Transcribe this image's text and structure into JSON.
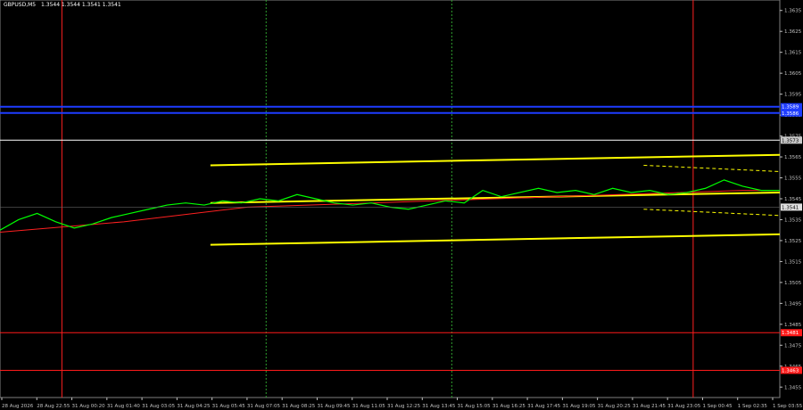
{
  "header": {
    "symbol": "GBPUSD,M5",
    "ohlc": "1.3544 1.3544 1.3541 1.3541"
  },
  "chart_data": {
    "type": "line",
    "title": "GBPUSD,M5  1.3544 1.3544 1.3541 1.3541",
    "ylim": [
      1.345,
      1.364
    ],
    "y_ticks": [
      "1.3635",
      "1.3625",
      "1.3615",
      "1.3605",
      "1.3595",
      "1.3585",
      "1.3575",
      "1.3565",
      "1.3555",
      "1.3545",
      "1.3535",
      "1.3525",
      "1.3515",
      "1.3505",
      "1.3495",
      "1.3485",
      "1.3475",
      "1.3465",
      "1.3455"
    ],
    "x_ticks": [
      "28 Aug 2026",
      "28 Aug 22:55",
      "31 Aug 00:20",
      "31 Aug 01:40",
      "31 Aug 03:05",
      "31 Aug 04:25",
      "31 Aug 05:45",
      "31 Aug 07:05",
      "31 Aug 08:25",
      "31 Aug 09:45",
      "31 Aug 11:05",
      "31 Aug 12:25",
      "31 Aug 13:45",
      "31 Aug 15:05",
      "31 Aug 16:25",
      "31 Aug 17:45",
      "31 Aug 19:05",
      "31 Aug 20:25",
      "31 Aug 21:45",
      "31 Aug 23:05",
      "1 Sep 00:45",
      "1 Sep 02:35",
      "1 Sep 03:55"
    ],
    "price_points": [
      [
        0,
        1.353
      ],
      [
        3,
        1.3535
      ],
      [
        6,
        1.3538
      ],
      [
        9,
        1.3534
      ],
      [
        12,
        1.3531
      ],
      [
        15,
        1.3533
      ],
      [
        18,
        1.3536
      ],
      [
        21,
        1.3538
      ],
      [
        24,
        1.354
      ],
      [
        27,
        1.3542
      ],
      [
        30,
        1.3543
      ],
      [
        33,
        1.3542
      ],
      [
        36,
        1.3544
      ],
      [
        39,
        1.3543
      ],
      [
        42,
        1.3545
      ],
      [
        45,
        1.3544
      ],
      [
        48,
        1.3547
      ],
      [
        51,
        1.3545
      ],
      [
        54,
        1.3543
      ],
      [
        57,
        1.3542
      ],
      [
        60,
        1.3543
      ],
      [
        63,
        1.3541
      ],
      [
        66,
        1.354
      ],
      [
        69,
        1.3542
      ],
      [
        72,
        1.3544
      ],
      [
        75,
        1.3543
      ],
      [
        78,
        1.3549
      ],
      [
        81,
        1.3546
      ],
      [
        84,
        1.3548
      ],
      [
        87,
        1.355
      ],
      [
        90,
        1.3548
      ],
      [
        93,
        1.3549
      ],
      [
        96,
        1.3547
      ],
      [
        99,
        1.355
      ],
      [
        102,
        1.3548
      ],
      [
        105,
        1.3549
      ],
      [
        108,
        1.3547
      ],
      [
        111,
        1.3548
      ],
      [
        114,
        1.355
      ],
      [
        117,
        1.3554
      ],
      [
        120,
        1.3551
      ],
      [
        123,
        1.3549
      ],
      [
        126,
        1.3549
      ]
    ],
    "ma_points": [
      [
        0,
        1.3529
      ],
      [
        20,
        1.3534
      ],
      [
        40,
        1.3541
      ],
      [
        60,
        1.3543
      ],
      [
        80,
        1.3545
      ],
      [
        100,
        1.3547
      ],
      [
        120,
        1.3549
      ],
      [
        126,
        1.3549
      ]
    ],
    "channel_upper": [
      [
        34,
        1.3561
      ],
      [
        126,
        1.3566
      ]
    ],
    "channel_middle": [
      [
        34,
        1.3543
      ],
      [
        126,
        1.3548
      ]
    ],
    "channel_lower": [
      [
        34,
        1.3523
      ],
      [
        126,
        1.3528
      ]
    ],
    "dashed_upper": [
      [
        104,
        1.3561
      ],
      [
        126,
        1.3558
      ]
    ],
    "dashed_lower": [
      [
        104,
        1.354
      ],
      [
        126,
        1.3537
      ]
    ],
    "horizontal_levels": [
      {
        "label": "1.3589",
        "value": 1.3589,
        "color": "#1e3cff"
      },
      {
        "label": "1.3586",
        "value": 1.3586,
        "color": "#1e3cff"
      },
      {
        "label": "1.3573",
        "value": 1.3573,
        "color": "#ffffff"
      },
      {
        "label": "1.3481",
        "value": 1.3481,
        "color": "#ff1a1a"
      },
      {
        "label": "1.3463",
        "value": 1.3463,
        "color": "#ff1a1a"
      }
    ],
    "current_price": {
      "label": "1.3541",
      "value": 1.3541
    },
    "vertical_markers": [
      {
        "position": 10,
        "color": "#ff2020",
        "style": "solid"
      },
      {
        "position": 43,
        "color": "#2ea02e",
        "style": "dotted"
      },
      {
        "position": 73,
        "color": "#2ea02e",
        "style": "dotted"
      },
      {
        "position": 112,
        "color": "#ff2020",
        "style": "solid"
      }
    ],
    "colors": {
      "background": "#000000",
      "price": "#00ff00",
      "ma": "#ff2020",
      "channel": "#ffff00",
      "grid": "#1a1a1a",
      "axis_text": "#c0c0c0"
    }
  }
}
